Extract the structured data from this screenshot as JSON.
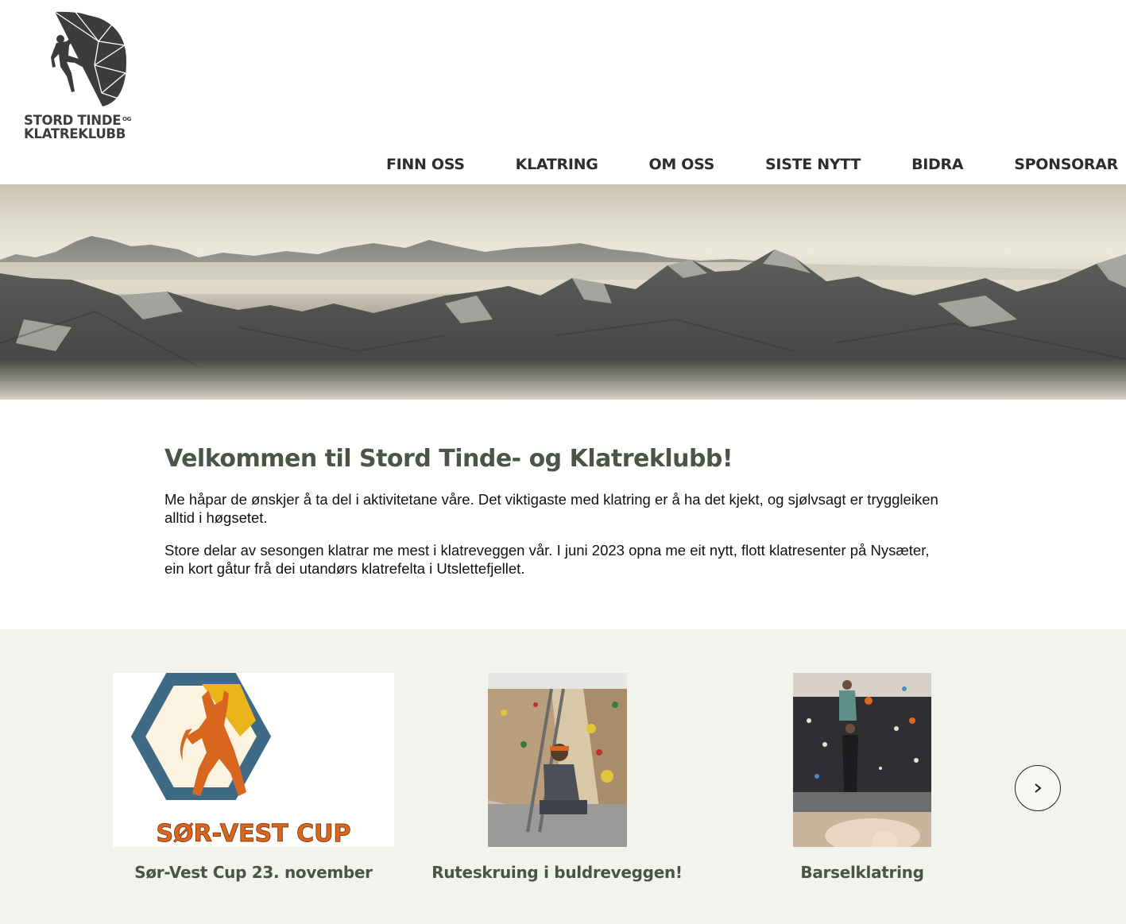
{
  "site": {
    "logo_text_line1": "STORD TINDE",
    "logo_text_og": "OG",
    "logo_text_line2": "KLATREKLUBB"
  },
  "nav": {
    "items": [
      {
        "label": "FINN OSS"
      },
      {
        "label": "KLATRING"
      },
      {
        "label": "OM OSS"
      },
      {
        "label": "SISTE NYTT"
      },
      {
        "label": "BIDRA"
      },
      {
        "label": "SPONSORAR"
      }
    ]
  },
  "welcome": {
    "title": "Velkommen til Stord Tinde- og Klatreklubb!",
    "paragraph1": "Me håpar de ønskjer å ta del i aktivitetane våre. Det viktigaste med klatring er å ha det kjekt, og sjølvsagt er tryggleiken alltid i høgsetet.",
    "paragraph2": "Store delar av sesongen klatrar me mest i klatreveggen vår. I juni 2023 opna me eit nytt, flott klatresenter på Nysæter, ein kort gåtur frå dei utandørs klatrefelta i Utslettefjellet."
  },
  "news": {
    "cards": [
      {
        "title": "Sør-Vest Cup 23. november",
        "image_text": "SØR-VEST CUP"
      },
      {
        "title": "Ruteskruing i buldreveggen!"
      },
      {
        "title": "Barselklatring"
      }
    ],
    "next_icon": "chevron-right-icon"
  },
  "colors": {
    "heading": "#4c5446",
    "nav": "#2d2d2d",
    "news_bg": "#f3f3ee",
    "logo_gray": "#3c3c3c",
    "cup_orange": "#d9661f",
    "cup_blue": "#3f6a85"
  }
}
